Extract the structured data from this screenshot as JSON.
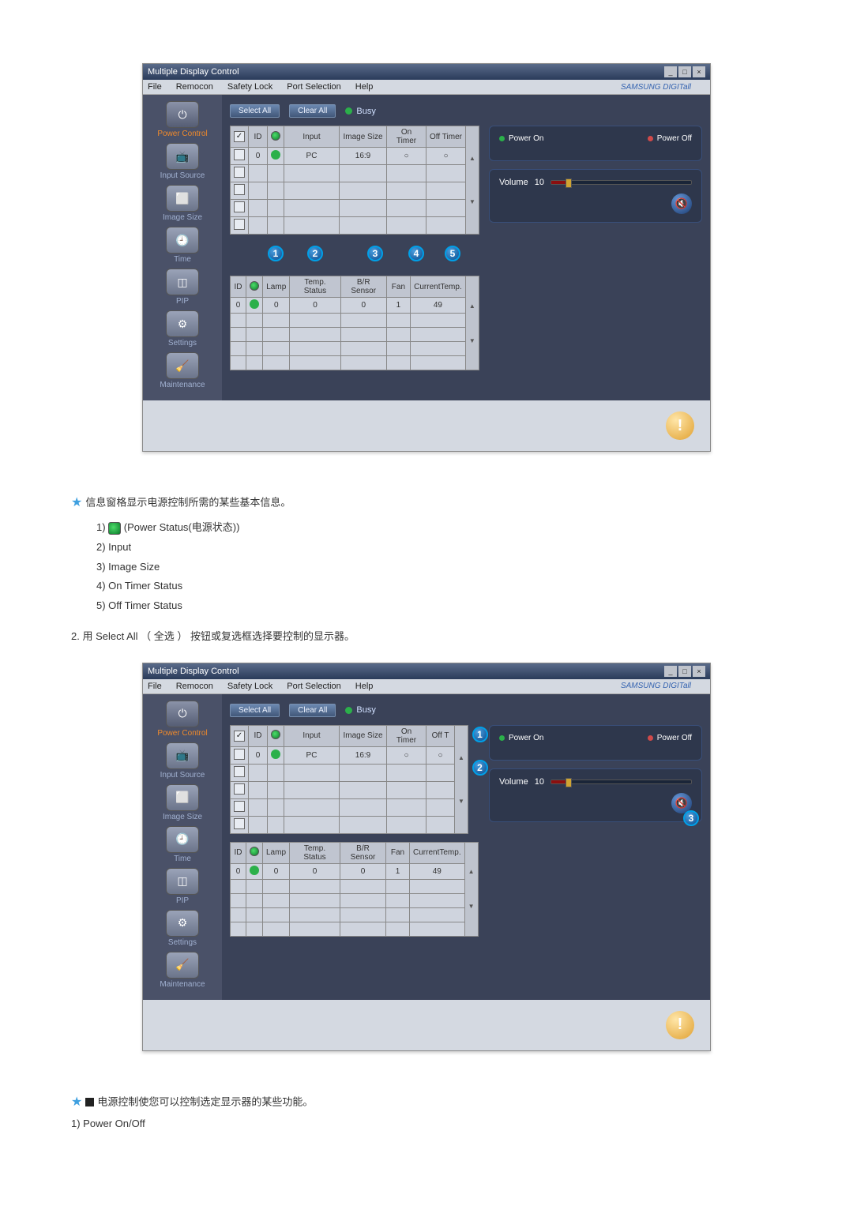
{
  "app": {
    "title": "Multiple Display Control",
    "brand": "SAMSUNG DIGITall"
  },
  "menu": {
    "file": "File",
    "remocon": "Remocon",
    "safety_lock": "Safety Lock",
    "port_selection": "Port Selection",
    "help": "Help"
  },
  "sidebar": {
    "items": [
      {
        "label": "Power Control"
      },
      {
        "label": "Input Source"
      },
      {
        "label": "Image Size"
      },
      {
        "label": "Time"
      },
      {
        "label": "PIP"
      },
      {
        "label": "Settings"
      },
      {
        "label": "Maintenance"
      }
    ]
  },
  "actions": {
    "select_all": "Select All",
    "clear_all": "Clear All",
    "busy": "Busy"
  },
  "table1": {
    "headers": {
      "chk": "✓",
      "id": "ID",
      "power": "",
      "input": "Input",
      "image_size": "Image Size",
      "on_timer": "On Timer",
      "off_timer": "Off Timer"
    },
    "row": {
      "id": "0",
      "input": "PC",
      "image_size": "16:9"
    }
  },
  "table2": {
    "headers": {
      "id": "ID",
      "power": "",
      "lamp": "Lamp",
      "temp_status": "Temp. Status",
      "br_sensor": "B/R Sensor",
      "fan": "Fan",
      "current_temp": "CurrentTemp."
    },
    "row": {
      "id": "0",
      "lamp": "0",
      "temp_status": "0",
      "br_sensor": "0",
      "fan": "1",
      "current_temp": "49"
    }
  },
  "right": {
    "power_on": "Power On",
    "power_off": "Power Off",
    "volume_label": "Volume",
    "volume_value": "10"
  },
  "callouts": {
    "c1": "1",
    "c2": "2",
    "c3": "3",
    "c4": "4",
    "c5": "5"
  },
  "doc": {
    "line1_before": "信息窗格显示电源控制所需的某些基本信息。",
    "items": {
      "i1a": "1) ",
      "i1b": " (Power Status(电源状态))",
      "i2": "2) Input",
      "i3": "3) Image Size",
      "i4": "4) On Timer Status",
      "i5": "5) Off Timer Status"
    },
    "line2": "2. 用 Select All （ 全选 ） 按钮或复选框选择要控制的显示器。",
    "line3_after": "电源控制使您可以控制选定显示器的某些功能。",
    "line4": "1) Power On/Off"
  }
}
